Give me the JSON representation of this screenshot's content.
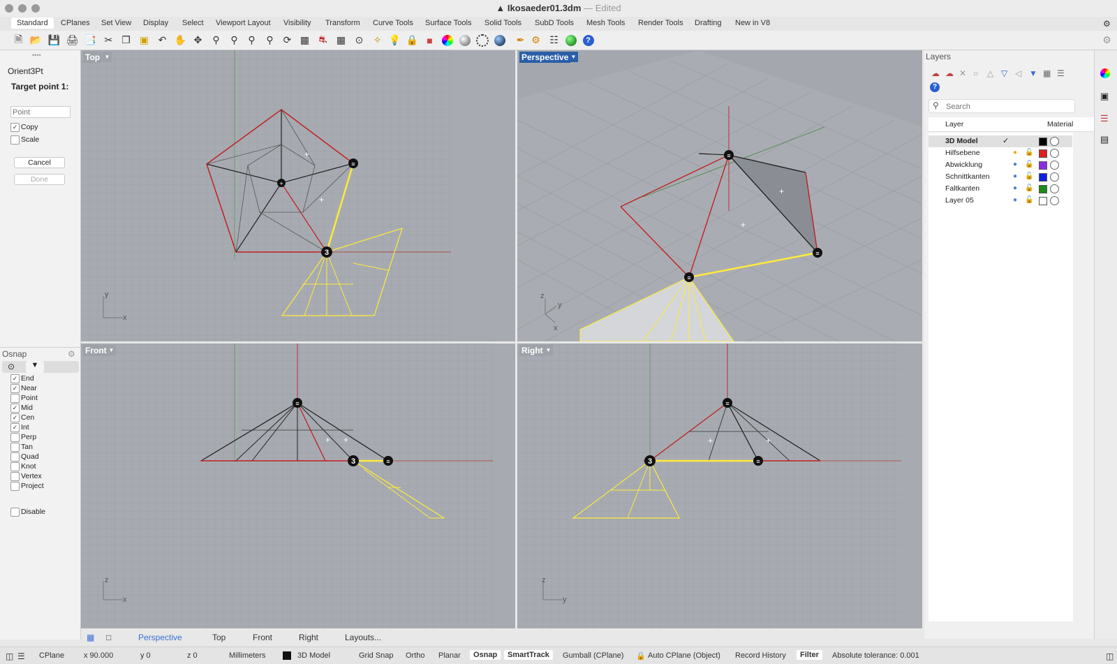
{
  "window": {
    "file": "Ikosaeder01.3dm",
    "separator": "—",
    "state": "Edited"
  },
  "tabs": [
    "Standard",
    "CPlanes",
    "Set View",
    "Display",
    "Select",
    "Viewport Layout",
    "Visibility",
    "Transform",
    "Curve Tools",
    "Surface Tools",
    "Solid Tools",
    "SubD Tools",
    "Mesh Tools",
    "Render Tools",
    "Drafting",
    "New in V8"
  ],
  "toolbar_icons": [
    "new-file",
    "open-file",
    "save",
    "print",
    "properties",
    "cut",
    "copy",
    "paste",
    "undo",
    "pan",
    "rotate-view",
    "zoom",
    "zoom-window",
    "zoom-extents",
    "zoom-selected",
    "rotate-3d",
    "four-viewports",
    "car-display",
    "grid",
    "snap",
    "light",
    "lock",
    "materials",
    "color-wheel",
    "shaded-sphere",
    "wireframe-sphere",
    "render-sphere",
    "settings",
    "network",
    "globe",
    "help"
  ],
  "command": {
    "name": "Orient3Pt",
    "prompt": "Target point 1:",
    "input_placeholder": "Point",
    "options": [
      {
        "label": "Copy",
        "checked": true
      },
      {
        "label": "Scale",
        "checked": false
      }
    ],
    "cancel_label": "Cancel",
    "done_label": "Done"
  },
  "osnap": {
    "title": "Osnap",
    "items": [
      {
        "label": "End",
        "checked": true
      },
      {
        "label": "Near",
        "checked": true
      },
      {
        "label": "Point",
        "checked": false
      },
      {
        "label": "Mid",
        "checked": true
      },
      {
        "label": "Cen",
        "checked": true
      },
      {
        "label": "Int",
        "checked": true
      },
      {
        "label": "Perp",
        "checked": false
      },
      {
        "label": "Tan",
        "checked": false
      },
      {
        "label": "Quad",
        "checked": false
      },
      {
        "label": "Knot",
        "checked": false
      },
      {
        "label": "Vertex",
        "checked": false
      },
      {
        "label": "Project",
        "checked": false
      }
    ],
    "disable_label": "Disable"
  },
  "viewports": {
    "top": {
      "label": "Top",
      "axis_a": "y",
      "axis_b": "x",
      "point_label": "3"
    },
    "perspective": {
      "label": "Perspective",
      "axis_a": "z",
      "axis_b": "y",
      "axis_c": "x"
    },
    "front": {
      "label": "Front",
      "axis_a": "z",
      "axis_b": "x",
      "point_label": "3"
    },
    "right": {
      "label": "Right",
      "axis_a": "z",
      "axis_b": "y",
      "point_label": "3"
    }
  },
  "layers": {
    "title": "Layers",
    "search_placeholder": "Search",
    "col_layer": "Layer",
    "col_material": "Material",
    "current_mark": "✓",
    "rows": [
      {
        "name": "3D Model",
        "color": "#000000",
        "current": true
      },
      {
        "name": "Hilfsebene",
        "color": "#e02020",
        "bulb": "#e8b020"
      },
      {
        "name": "Abwicklung",
        "color": "#8a2be2",
        "bulb": "#4a7fd6"
      },
      {
        "name": "Schnittkanten",
        "color": "#1020e0",
        "bulb": "#4a7fd6"
      },
      {
        "name": "Faltkanten",
        "color": "#1a8a1a",
        "bulb": "#4a7fd6"
      },
      {
        "name": "Layer 05",
        "color": "#ffffff",
        "bulb": "#4a7fd6"
      }
    ]
  },
  "viewport_tabs": {
    "perspective": "Perspective",
    "top": "Top",
    "front": "Front",
    "right": "Right",
    "layouts": "Layouts..."
  },
  "status": {
    "cplane": "CPlane",
    "x": "x 90.000",
    "y": "y 0",
    "z": "z 0",
    "units": "Millimeters",
    "layer": "3D Model",
    "grid_snap": "Grid Snap",
    "ortho": "Ortho",
    "planar": "Planar",
    "osnap": "Osnap",
    "smarttrack": "SmartTrack",
    "gumball": "Gumball (CPlane)",
    "auto_cplane": "Auto CPlane (Object)",
    "record_history": "Record History",
    "filter": "Filter",
    "tolerance": "Absolute tolerance: 0.001"
  }
}
